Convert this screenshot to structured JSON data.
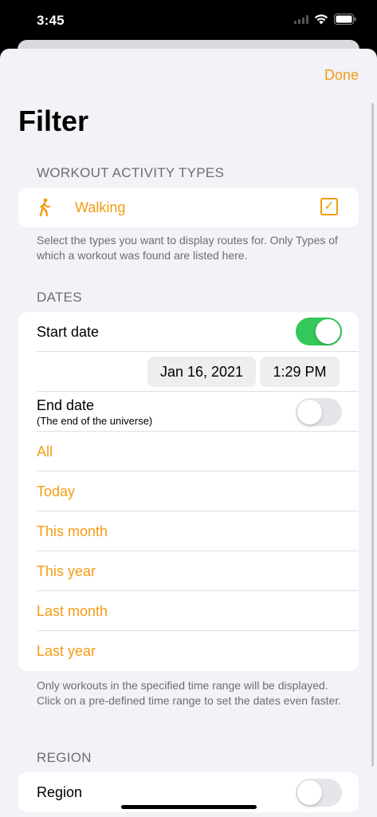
{
  "status_bar": {
    "time": "3:45"
  },
  "header": {
    "done_label": "Done",
    "title": "Filter"
  },
  "activity_types": {
    "header": "WORKOUT ACTIVITY TYPES",
    "items": [
      {
        "label": "Walking",
        "icon": "walking-figure-icon",
        "checked": true
      }
    ],
    "footer": "Select the types you want to display routes for. Only Types of which a workout was found are listed here."
  },
  "dates": {
    "header": "DATES",
    "start_date": {
      "label": "Start date",
      "enabled": true,
      "date": "Jan 16, 2021",
      "time": "1:29 PM"
    },
    "end_date": {
      "label": "End date",
      "sublabel": "(The end of the universe)",
      "enabled": false
    },
    "presets": [
      "All",
      "Today",
      "This month",
      "This year",
      "Last month",
      "Last year"
    ],
    "footer": "Only workouts in the specified time range will be displayed. Click on a pre-defined time range to set the dates even faster."
  },
  "region": {
    "header": "REGION",
    "toggle": {
      "label": "Region",
      "enabled": false
    }
  },
  "colors": {
    "accent": "#f39c12",
    "toggle_on": "#34c759",
    "background": "#f2f2f7"
  }
}
